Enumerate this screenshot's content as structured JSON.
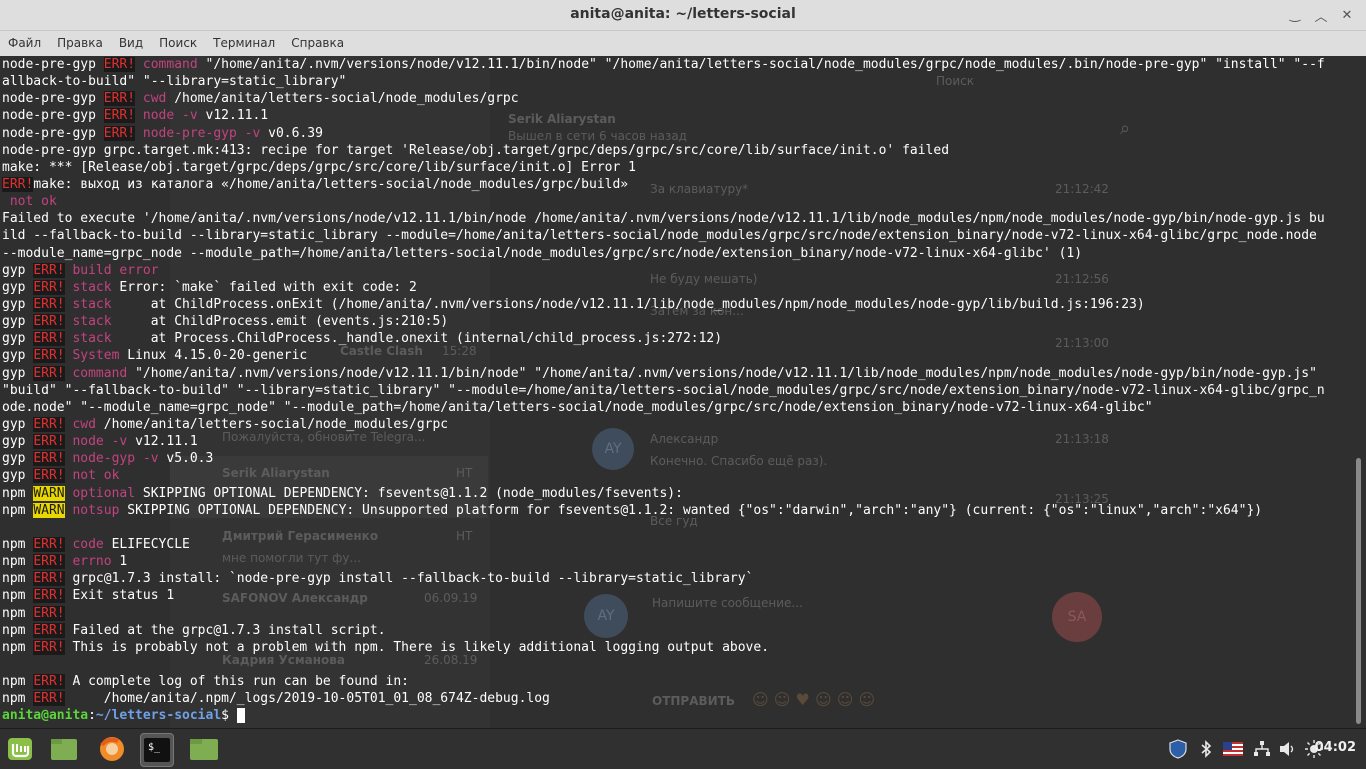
{
  "window": {
    "title": "anita@anita: ~/letters-social",
    "controls": {
      "minimize": "‿",
      "maximize": "︿",
      "close": "✕"
    }
  },
  "menu": [
    "Файл",
    "Правка",
    "Вид",
    "Поиск",
    "Терминал",
    "Справка"
  ],
  "terminal": {
    "lines": [
      [
        {
          "t": "node-pre-gyp "
        },
        {
          "t": "ERR!",
          "c": "err"
        },
        {
          "t": " command",
          "c": "mag"
        },
        {
          "t": " \"/home/anita/.nvm/versions/node/v12.11.1/bin/node\" \"/home/anita/letters-social/node_modules/grpc/node_modules/.bin/node-pre-gyp\" \"install\" \"--f"
        }
      ],
      [
        {
          "t": "allback-to-build\" \"--library=static_library\""
        }
      ],
      [
        {
          "t": "node-pre-gyp "
        },
        {
          "t": "ERR!",
          "c": "err"
        },
        {
          "t": " cwd",
          "c": "mag"
        },
        {
          "t": " /home/anita/letters-social/node_modules/grpc"
        }
      ],
      [
        {
          "t": "node-pre-gyp "
        },
        {
          "t": "ERR!",
          "c": "err"
        },
        {
          "t": " node -v",
          "c": "mag"
        },
        {
          "t": " v12.11.1"
        }
      ],
      [
        {
          "t": "node-pre-gyp "
        },
        {
          "t": "ERR!",
          "c": "err"
        },
        {
          "t": " node-pre-gyp -v",
          "c": "mag"
        },
        {
          "t": " v0.6.39"
        }
      ],
      [
        {
          "t": "node-pre-gyp grpc.target.mk:413: recipe for target 'Release/obj.target/grpc/deps/grpc/src/core/lib/surface/init.o' failed"
        }
      ],
      [
        {
          "t": "make: *** [Release/obj.target/grpc/deps/grpc/src/core/lib/surface/init.o] Error 1"
        }
      ],
      [
        {
          "t": "ERR!",
          "c": "err"
        },
        {
          "t": "make: выход из каталога «/home/anita/letters-social/node_modules/grpc/build»"
        }
      ],
      [
        {
          "t": " not ok",
          "c": "mag"
        }
      ],
      [
        {
          "t": "Failed to execute '/home/anita/.nvm/versions/node/v12.11.1/bin/node /home/anita/.nvm/versions/node/v12.11.1/lib/node_modules/npm/node_modules/node-gyp/bin/node-gyp.js bu"
        }
      ],
      [
        {
          "t": "ild --fallback-to-build --library=static_library --module=/home/anita/letters-social/node_modules/grpc/src/node/extension_binary/node-v72-linux-x64-glibc/grpc_node.node"
        }
      ],
      [
        {
          "t": "--module_name=grpc_node --module_path=/home/anita/letters-social/node_modules/grpc/src/node/extension_binary/node-v72-linux-x64-glibc' (1)"
        }
      ],
      [
        {
          "t": "gyp "
        },
        {
          "t": "ERR!",
          "c": "err"
        },
        {
          "t": " build error",
          "c": "mag"
        }
      ],
      [
        {
          "t": "gyp "
        },
        {
          "t": "ERR!",
          "c": "err"
        },
        {
          "t": " stack",
          "c": "mag"
        },
        {
          "t": " Error: `make` failed with exit code: 2"
        }
      ],
      [
        {
          "t": "gyp "
        },
        {
          "t": "ERR!",
          "c": "err"
        },
        {
          "t": " stack",
          "c": "mag"
        },
        {
          "t": "     at ChildProcess.onExit (/home/anita/.nvm/versions/node/v12.11.1/lib/node_modules/npm/node_modules/node-gyp/lib/build.js:196:23)"
        }
      ],
      [
        {
          "t": "gyp "
        },
        {
          "t": "ERR!",
          "c": "err"
        },
        {
          "t": " stack",
          "c": "mag"
        },
        {
          "t": "     at ChildProcess.emit (events.js:210:5)"
        }
      ],
      [
        {
          "t": "gyp "
        },
        {
          "t": "ERR!",
          "c": "err"
        },
        {
          "t": " stack",
          "c": "mag"
        },
        {
          "t": "     at Process.ChildProcess._handle.onexit (internal/child_process.js:272:12)"
        }
      ],
      [
        {
          "t": "gyp "
        },
        {
          "t": "ERR!",
          "c": "err"
        },
        {
          "t": " System",
          "c": "mag"
        },
        {
          "t": " Linux 4.15.0-20-generic"
        }
      ],
      [
        {
          "t": "gyp "
        },
        {
          "t": "ERR!",
          "c": "err"
        },
        {
          "t": " command",
          "c": "mag"
        },
        {
          "t": " \"/home/anita/.nvm/versions/node/v12.11.1/bin/node\" \"/home/anita/.nvm/versions/node/v12.11.1/lib/node_modules/npm/node_modules/node-gyp/bin/node-gyp.js\""
        }
      ],
      [
        {
          "t": "\"build\" \"--fallback-to-build\" \"--library=static_library\" \"--module=/home/anita/letters-social/node_modules/grpc/src/node/extension_binary/node-v72-linux-x64-glibc/grpc_n"
        }
      ],
      [
        {
          "t": "ode.node\" \"--module_name=grpc_node\" \"--module_path=/home/anita/letters-social/node_modules/grpc/src/node/extension_binary/node-v72-linux-x64-glibc\""
        }
      ],
      [
        {
          "t": "gyp "
        },
        {
          "t": "ERR!",
          "c": "err"
        },
        {
          "t": " cwd",
          "c": "mag"
        },
        {
          "t": " /home/anita/letters-social/node_modules/grpc"
        }
      ],
      [
        {
          "t": "gyp "
        },
        {
          "t": "ERR!",
          "c": "err"
        },
        {
          "t": " node -v",
          "c": "mag"
        },
        {
          "t": " v12.11.1"
        }
      ],
      [
        {
          "t": "gyp "
        },
        {
          "t": "ERR!",
          "c": "err"
        },
        {
          "t": " node-gyp -v",
          "c": "mag"
        },
        {
          "t": " v5.0.3"
        }
      ],
      [
        {
          "t": "gyp "
        },
        {
          "t": "ERR!",
          "c": "err"
        },
        {
          "t": " not ok",
          "c": "mag"
        }
      ],
      [
        {
          "t": "npm "
        },
        {
          "t": "WARN",
          "c": "warn"
        },
        {
          "t": " optional",
          "c": "mag"
        },
        {
          "t": " SKIPPING OPTIONAL DEPENDENCY: fsevents@1.1.2 (node_modules/fsevents):"
        }
      ],
      [
        {
          "t": "npm "
        },
        {
          "t": "WARN",
          "c": "warn"
        },
        {
          "t": " notsup",
          "c": "mag"
        },
        {
          "t": " SKIPPING OPTIONAL DEPENDENCY: Unsupported platform for fsevents@1.1.2: wanted {\"os\":\"darwin\",\"arch\":\"any\"} (current: {\"os\":\"linux\",\"arch\":\"x64\"})"
        }
      ],
      [
        {
          "t": ""
        }
      ],
      [
        {
          "t": "npm "
        },
        {
          "t": "ERR!",
          "c": "err"
        },
        {
          "t": " code",
          "c": "mag"
        },
        {
          "t": " ELIFECYCLE"
        }
      ],
      [
        {
          "t": "npm "
        },
        {
          "t": "ERR!",
          "c": "err"
        },
        {
          "t": " errno",
          "c": "mag"
        },
        {
          "t": " 1"
        }
      ],
      [
        {
          "t": "npm "
        },
        {
          "t": "ERR!",
          "c": "err"
        },
        {
          "t": " grpc@1.7.3 install: `node-pre-gyp install --fallback-to-build --library=static_library`"
        }
      ],
      [
        {
          "t": "npm "
        },
        {
          "t": "ERR!",
          "c": "err"
        },
        {
          "t": " Exit status 1"
        }
      ],
      [
        {
          "t": "npm "
        },
        {
          "t": "ERR!",
          "c": "err"
        }
      ],
      [
        {
          "t": "npm "
        },
        {
          "t": "ERR!",
          "c": "err"
        },
        {
          "t": " Failed at the grpc@1.7.3 install script."
        }
      ],
      [
        {
          "t": "npm "
        },
        {
          "t": "ERR!",
          "c": "err"
        },
        {
          "t": " This is probably not a problem with npm. There is likely additional logging output above."
        }
      ],
      [
        {
          "t": ""
        }
      ],
      [
        {
          "t": "npm "
        },
        {
          "t": "ERR!",
          "c": "err"
        },
        {
          "t": " A complete log of this run can be found in:"
        }
      ],
      [
        {
          "t": "npm "
        },
        {
          "t": "ERR!",
          "c": "err"
        },
        {
          "t": "     /home/anita/.npm/_logs/2019-10-05T01_01_08_674Z-debug.log"
        }
      ]
    ],
    "prompt_user": "anita@anita",
    "prompt_sep": ":",
    "prompt_path": "~/letters-social",
    "prompt_symbol": "$ "
  },
  "background_app": {
    "search_placeholder": "Поиск",
    "header_name": "Serik Aliarystan",
    "header_status": "Вышел в сети 6 часов назад",
    "messages": [
      {
        "text": "За клавиатуру*",
        "time": "21:12:42"
      },
      {
        "text": "Не буду мешать)",
        "time": "21:12:56"
      },
      {
        "text": "Затем за кон...",
        "time": "21:13:00"
      },
      {
        "author": "Александр",
        "text": "Конечно. Спасибо ещё раз).",
        "time": "21:13:18"
      },
      {
        "text": "Все гуд",
        "time": "21:13:25"
      }
    ],
    "chats": [
      {
        "name": "Castle Clash",
        "time": "15:28"
      },
      {
        "name": "Serik Aliarystan",
        "time": "НТ"
      },
      {
        "name": "Дмитрий Герасименко",
        "time": "НТ",
        "preview": "мне помогли тут фу..."
      },
      {
        "name": "SAFONOV Александр",
        "time": "06.09.19"
      },
      {
        "name": "Кадрия Усманова",
        "time": "26.08.19"
      }
    ],
    "update_hint": "Пожалуйста, обновите Telegra...",
    "compose_placeholder": "Напишите сообщение...",
    "send_label": "ОТПРАВИТЬ",
    "avatar_ay": "AY",
    "avatar_sa": "SA"
  },
  "taskbar": {
    "clock": "04:02",
    "apps": [
      "mint-menu-icon",
      "files-icon",
      "firefox-icon",
      "terminal-icon",
      "folder-icon"
    ]
  },
  "colors": {
    "terminal_bg": "#2f2f2f",
    "err_fg": "#e03030",
    "warn_bg": "#e8d800",
    "label_magenta": "#c1437f",
    "prompt_user": "#5ad53a",
    "prompt_path": "#6fa0e8"
  }
}
